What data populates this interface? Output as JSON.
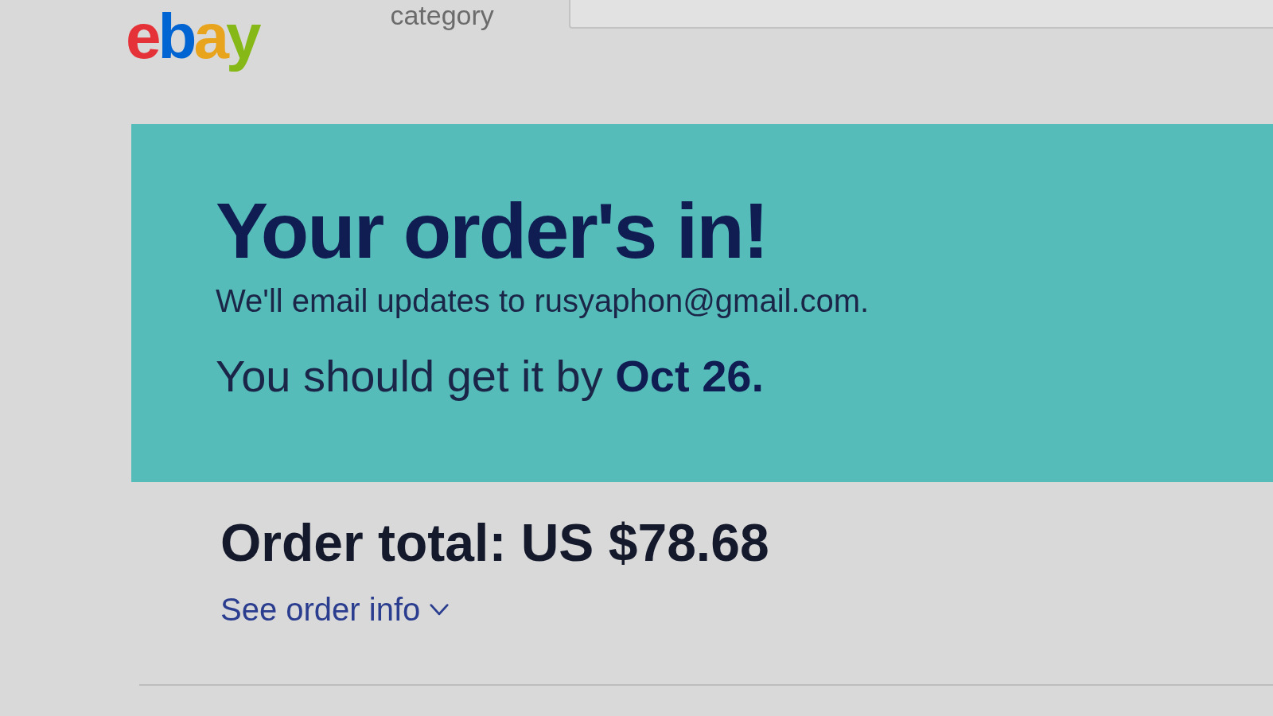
{
  "header": {
    "logo": "ebay",
    "category_label": "category"
  },
  "banner": {
    "title": "Your order's in!",
    "email_note": "We'll email updates to rusyaphon@gmail.com.",
    "delivery_note": "You should get it by **Oct 26.**"
  },
  "order_total": "Order total: US $78.68",
  "order_info_link": {
    "label": "See order info",
    "expanded": false
  }
}
